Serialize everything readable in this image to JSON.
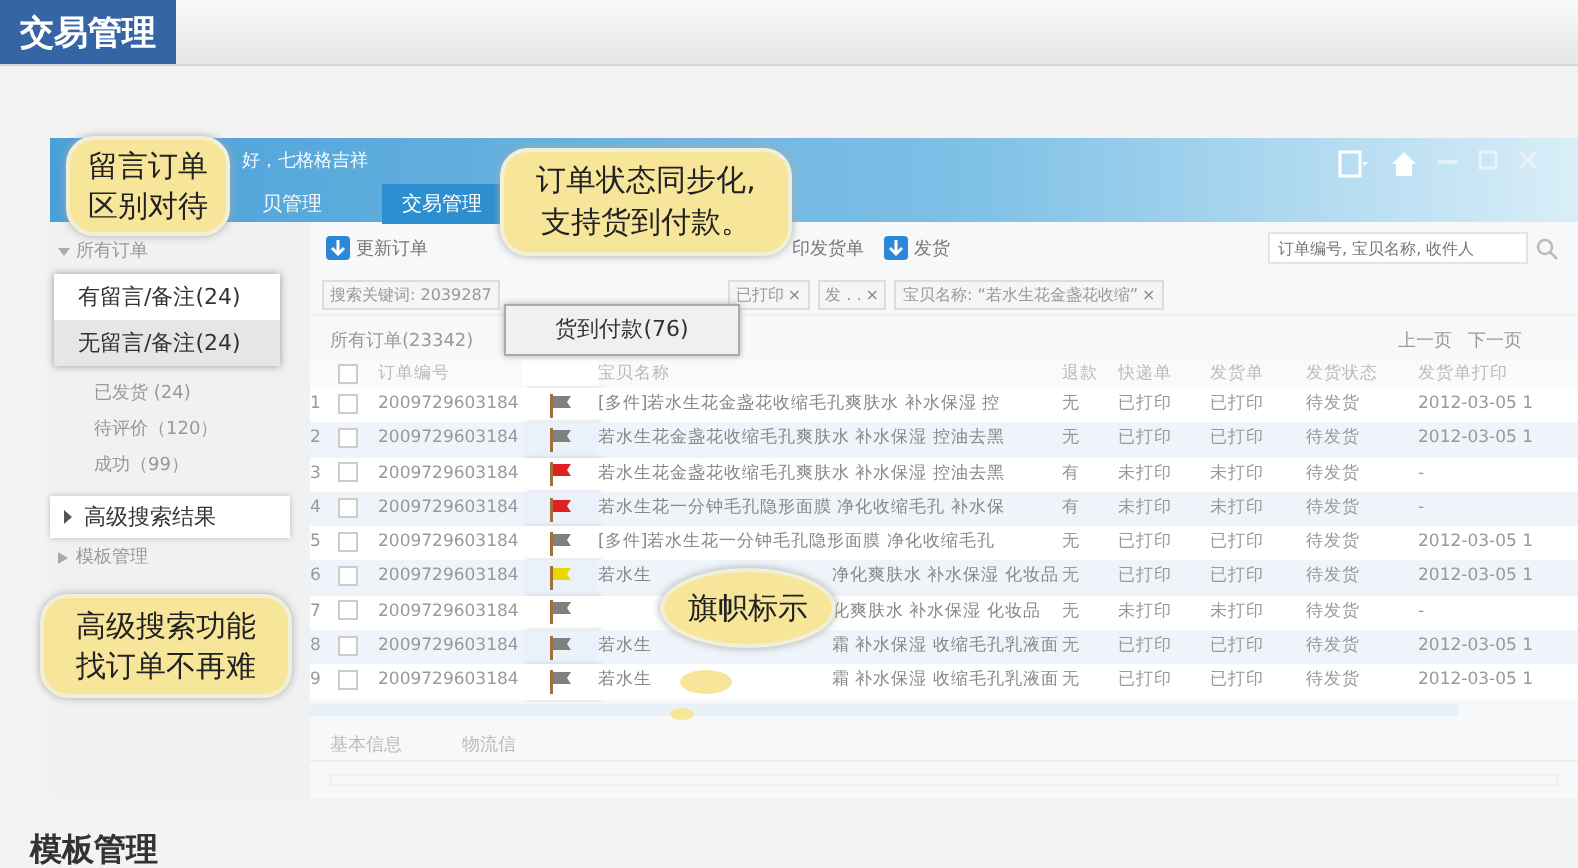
{
  "header": {
    "title": "交易管理"
  },
  "app": {
    "greeting": "好，七格格吉祥",
    "nav": [
      {
        "label": "贝管理",
        "selected": false
      },
      {
        "label": "交易管理",
        "selected": true
      }
    ]
  },
  "sidebar": {
    "section": "所有订单",
    "items": [
      "已发货 (24)",
      "待评价（120）",
      "成功（99）"
    ],
    "advanced": "高级搜索结果",
    "template": "模板管理"
  },
  "filter_popup": [
    {
      "label": "有留言/备注(24)",
      "selected": false
    },
    {
      "label": "无留言/备注(24)",
      "selected": true
    }
  ],
  "toolbar": {
    "buttons": [
      {
        "label": "更新订单",
        "kind": "download"
      },
      {
        "label": "印发货单",
        "kind": "plain"
      },
      {
        "label": "发货",
        "kind": "download"
      }
    ],
    "search": {
      "placeholder": "订单编号, 宝贝名称, 收件人"
    }
  },
  "chips": [
    {
      "label": "搜索关键词: 2039287"
    },
    {
      "label": "已打印",
      "close": "×"
    },
    {
      "label": "发 . .",
      "close": "×"
    },
    {
      "label": "宝贝名称: “若水生花金盏花收缩”",
      "close": "×"
    }
  ],
  "payment_popup": {
    "label": "货到付款(76)"
  },
  "table": {
    "tab": "所有订单(23342)",
    "pager": [
      "上一页",
      "下一页"
    ],
    "all_checked": false,
    "columns": [
      "订单编号",
      "宝贝名称",
      "退款",
      "快递单",
      "发货单",
      "发货状态",
      "发货单打印"
    ],
    "rows": [
      {
        "index": "1",
        "checked": false,
        "order": "2009729603184",
        "color": "#808080",
        "name": {
          "before": "[多件]若水生花金盏花收缩毛孔爽肤水 补水保湿 控"
        },
        "refund": "无",
        "express": "已打印",
        "invoice": "已打印",
        "status": "待发货",
        "date": "2012-03-05 1"
      },
      {
        "index": "2",
        "checked": false,
        "order": "2009729603184",
        "color": "#808080",
        "name": {
          "before": "若水生花金盏花收缩毛孔爽肤水 补水保湿 控油去黑"
        },
        "refund": "无",
        "express": "已打印",
        "invoice": "已打印",
        "status": "待发货",
        "date": "2012-03-05 1"
      },
      {
        "index": "3",
        "checked": false,
        "order": "2009729603184",
        "color": "#e02020",
        "name": {
          "before": "若水生花金盏花收缩毛孔爽肤水 补水保湿 控油去黑"
        },
        "refund": "有",
        "express": "未打印",
        "invoice": "未打印",
        "status": "待发货",
        "date": "-"
      },
      {
        "index": "4",
        "checked": false,
        "order": "2009729603184",
        "color": "#e02020",
        "name": {
          "before": "若水生花一分钟毛孔隐形面膜 净化收缩毛孔 补水保"
        },
        "refund": "有",
        "express": "未打印",
        "invoice": "未打印",
        "status": "待发货",
        "date": "-"
      },
      {
        "index": "5",
        "checked": false,
        "order": "2009729603184",
        "color": "#808080",
        "name": {
          "before": "[多件]若水生花一分钟毛孔隐形面膜 净化收缩毛孔"
        },
        "refund": "无",
        "express": "已打印",
        "invoice": "已打印",
        "status": "待发货",
        "date": "2012-03-05 1"
      },
      {
        "index": "6",
        "checked": false,
        "order": "2009729603184",
        "color": "#e8d800",
        "name": {
          "before": "若水生",
          "after": "净化爽肤水 补水保湿 化妆品"
        },
        "refund": "无",
        "express": "已打印",
        "invoice": "已打印",
        "status": "待发货",
        "date": "2012-03-05 1"
      },
      {
        "index": "7",
        "checked": false,
        "order": "2009729603184",
        "color": "#808080",
        "name": {
          "after": "化爽肤水 补水保湿 化妆品"
        },
        "refund": "无",
        "express": "未打印",
        "invoice": "未打印",
        "status": "待发货",
        "date": "-"
      },
      {
        "index": "8",
        "checked": false,
        "order": "2009729603184",
        "color": "#808080",
        "name": {
          "before": "若水生",
          "after": "霜 补水保湿 收缩毛孔乳液面"
        },
        "refund": "无",
        "express": "已打印",
        "invoice": "已打印",
        "status": "待发货",
        "date": "2012-03-05 1"
      },
      {
        "index": "9",
        "checked": false,
        "order": "2009729603184",
        "color": "#808080",
        "name": {
          "before": "若水生",
          "after": "霜 补水保湿 收缩毛孔乳液面"
        },
        "refund": "无",
        "express": "已打印",
        "invoice": "已打印",
        "status": "待发货",
        "date": "2012-03-05 1"
      }
    ]
  },
  "detail_tabs": [
    "基本信息",
    "物流信"
  ],
  "callouts": [
    {
      "lines": [
        "留言订单",
        "区别对待"
      ],
      "kind": "topleft"
    },
    {
      "lines": [
        "订单状态同步化,",
        "支持货到付款。"
      ],
      "kind": "topmid"
    },
    {
      "lines": [
        "高级搜索功能",
        "找订单不再难"
      ],
      "kind": "bottomleft"
    },
    {
      "lines": [
        "旗帜标示"
      ],
      "kind": "oval"
    }
  ],
  "footer": {
    "title": "模板管理"
  }
}
